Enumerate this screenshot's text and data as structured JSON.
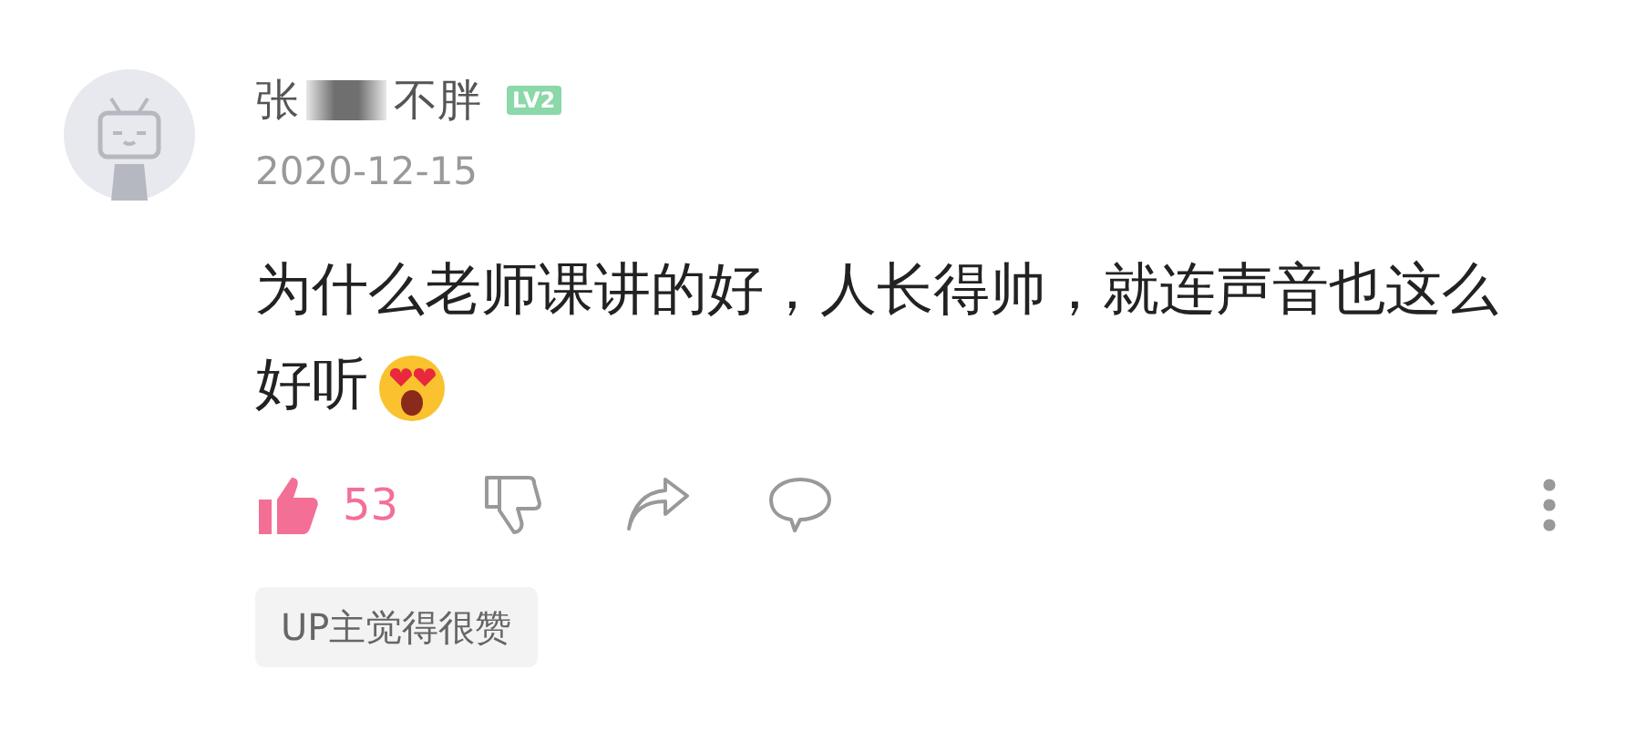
{
  "comment": {
    "username_start": "张",
    "username_end": "不胖",
    "level_badge": "LV2",
    "date": "2020-12-15",
    "text": "为什么老师课讲的好，人长得帅，就连声音也这么好听",
    "liked": true,
    "like_count": "53",
    "up_liked_tag": "UP主觉得很赞"
  }
}
